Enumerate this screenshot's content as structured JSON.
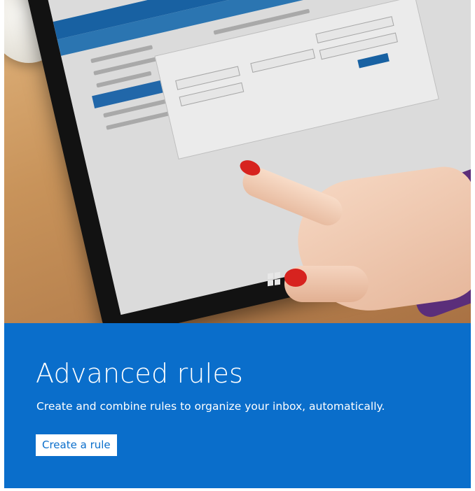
{
  "promo": {
    "title": "Advanced rules",
    "subtitle": "Create and combine rules to organize your inbox, automatically.",
    "cta_label": "Create a rule"
  },
  "colors": {
    "panel_background": "#0a6ecb",
    "title_text": "#ffffff",
    "button_background": "#ffffff",
    "button_text": "#0a6ecb"
  }
}
